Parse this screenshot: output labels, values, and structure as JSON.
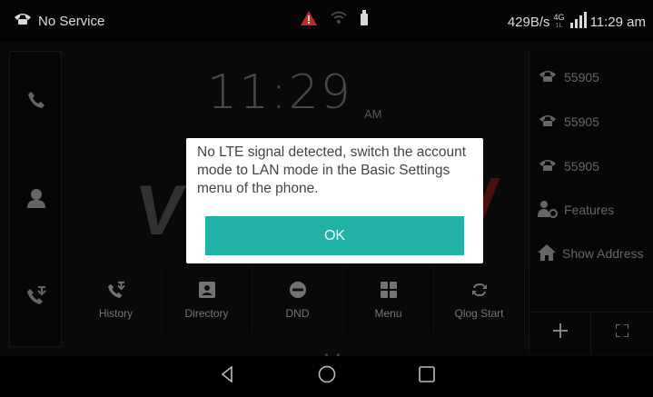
{
  "status_bar": {
    "service_text": "No Service",
    "speed": "429B/s",
    "network_type": "4G",
    "network_sub": "1L",
    "time": "11:29 am",
    "icons": [
      "phone-icon",
      "warning-icon",
      "wifi-icon",
      "usb-icon",
      "signal-icon"
    ],
    "warning_color": "#e0322d"
  },
  "home": {
    "clock_time": "11:29",
    "clock_ampm": "AM",
    "left_bar": [
      "phone-icon",
      "contacts-icon",
      "call-history-icon"
    ],
    "bottom_bar": [
      {
        "label": "History",
        "icon": "call-history-icon"
      },
      {
        "label": "Directory",
        "icon": "directory-icon"
      },
      {
        "label": "DND",
        "icon": "dnd-icon"
      },
      {
        "label": "Menu",
        "icon": "menu-grid-icon"
      },
      {
        "label": "Qlog Start",
        "icon": "qlog-icon"
      }
    ],
    "right_panel": [
      {
        "label": "55905",
        "icon": "phone-icon"
      },
      {
        "label": "55905",
        "icon": "phone-icon"
      },
      {
        "label": "55905",
        "icon": "phone-icon"
      },
      {
        "label": "Features",
        "icon": "features-icon"
      },
      {
        "label": "Show Address",
        "icon": "home-icon"
      }
    ],
    "right_footer": [
      "plus-icon",
      "expand-icon"
    ]
  },
  "dialog": {
    "message": "No LTE signal detected, switch the account mode to LAN mode in the Basic Settings menu of the phone.",
    "ok_label": "OK",
    "accent_color": "#1fb2a5"
  },
  "nav_bar": [
    "back-icon",
    "home-icon",
    "recents-icon"
  ]
}
